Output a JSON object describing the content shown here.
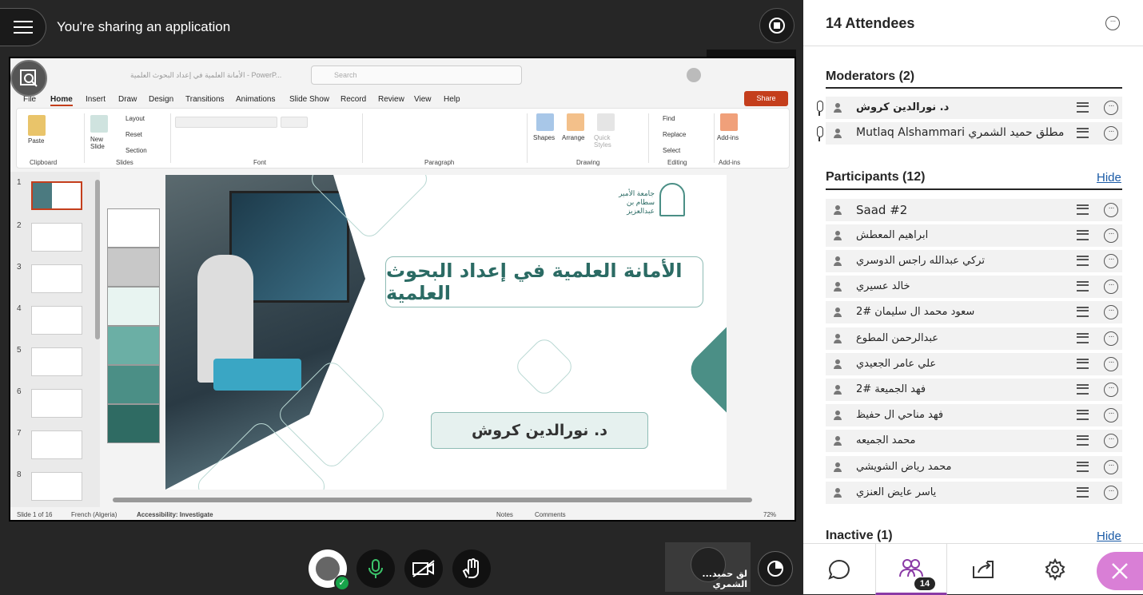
{
  "topbar": {
    "title": "You're sharing an application",
    "stop_tooltip": "Stop Sharing"
  },
  "ppt": {
    "window_title": "الأمانة العلمية في إعداد البحوث العلمية - PowerP...",
    "search_placeholder": "Search",
    "menu": [
      "File",
      "Home",
      "Insert",
      "Draw",
      "Design",
      "Transitions",
      "Animations",
      "Slide Show",
      "Record",
      "Review",
      "View",
      "Help"
    ],
    "active_menu": "Home",
    "share_label": "Share",
    "ribbon": {
      "clipboard": "Clipboard",
      "paste": "Paste",
      "slides": "Slides",
      "new_slide": "New Slide",
      "layout": "Layout",
      "reset": "Reset",
      "section": "Section",
      "font": "Font",
      "paragraph": "Paragraph",
      "drawing": "Drawing",
      "shapes": "Shapes",
      "arrange": "Arrange",
      "quick_styles": "Quick Styles",
      "editing": "Editing",
      "find": "Find",
      "replace": "Replace",
      "select": "Select",
      "addins_group": "Add-ins",
      "addins": "Add-ins"
    },
    "thumbnails": [
      "1",
      "2",
      "3",
      "4",
      "5",
      "6",
      "7",
      "8"
    ],
    "slide": {
      "title": "الأمانة العلمية في إعداد البحوث العلمية",
      "presenter": "د. نورالدين كروش",
      "logo_text": "جامعة الأمير سطام بن عبدالعزيز"
    },
    "status": {
      "slide_of": "Slide 1 of 16",
      "language": "French (Algeria)",
      "accessibility": "Accessibility: Investigate",
      "notes": "Notes",
      "comments": "Comments",
      "zoom": "72%"
    }
  },
  "video_tile": {
    "name": "...لق حميد الشمري"
  },
  "panel": {
    "title": "14 Attendees",
    "moderators_title": "Moderators (2)",
    "moderators": [
      {
        "name": "د. نورالدين كروش"
      },
      {
        "name": "Mutlaq Alshammari مطلق حميد الشمري"
      }
    ],
    "participants_title": "Participants (12)",
    "hide_label": "Hide",
    "participants": [
      {
        "name": "Saad #2"
      },
      {
        "name": "ابراهيم المعطش"
      },
      {
        "name": "تركي عبدالله راجس الدوسري"
      },
      {
        "name": "خالد عسيري"
      },
      {
        "name": "سعود محمد ال سليمان #2"
      },
      {
        "name": "عبدالرحمن المطوع"
      },
      {
        "name": "علي عامر الجعيدي"
      },
      {
        "name": "فهد الجميعة #2"
      },
      {
        "name": "فهد مناحي ال حفيظ"
      },
      {
        "name": "محمد الجميعه"
      },
      {
        "name": "محمد رياض الشويشي"
      },
      {
        "name": "ياسر عايض العنزي"
      }
    ],
    "inactive_title": "Inactive (1)",
    "inactive_hide": "Hide",
    "attendee_badge": "14"
  }
}
